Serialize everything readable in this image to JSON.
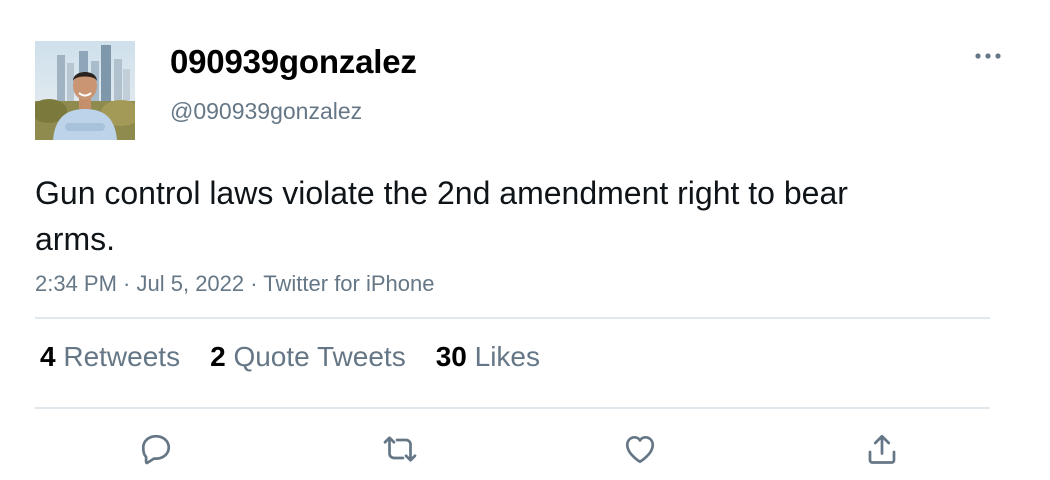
{
  "tweet": {
    "display_name": "090939gonzalez",
    "handle": "@090939gonzalez",
    "text": "Gun control laws violate the 2nd amendment right to bear arms.",
    "time": "2:34 PM",
    "date": "Jul 5, 2022",
    "source": "Twitter for iPhone",
    "separator": " · "
  },
  "stats": {
    "retweets": {
      "count": "4",
      "label": "Retweets"
    },
    "quote_tweets": {
      "count": "2",
      "label": "Quote Tweets"
    },
    "likes": {
      "count": "30",
      "label": "Likes"
    }
  },
  "icons": {
    "more": "more-horizontal-icon",
    "reply": "reply-icon",
    "retweet": "retweet-icon",
    "like": "heart-icon",
    "share": "share-icon"
  },
  "colors": {
    "text": "#0f1419",
    "secondary": "#657786",
    "divider": "#e1e8ed"
  }
}
